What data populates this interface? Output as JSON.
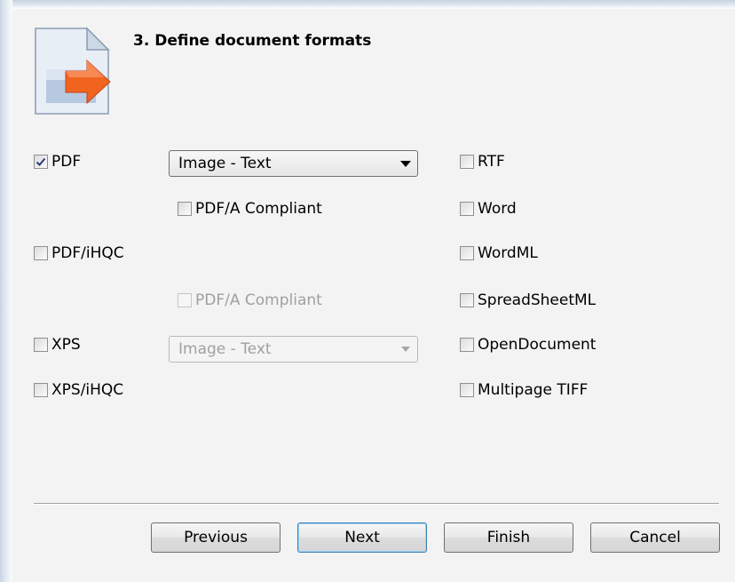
{
  "wizard": {
    "step_title": "3. Define document formats",
    "icon": "document-export-icon"
  },
  "formats": {
    "pdf": {
      "label": "PDF",
      "checked": true
    },
    "pdf_mode": {
      "selected": "Image - Text",
      "enabled": true
    },
    "pdf_a": {
      "label": "PDF/A Compliant",
      "checked": false,
      "enabled": true
    },
    "pdf_ihqc": {
      "label": "PDF/iHQC",
      "checked": false
    },
    "pdf_ihqc_a": {
      "label": "PDF/A Compliant",
      "checked": false,
      "enabled": false
    },
    "xps": {
      "label": "XPS",
      "checked": false
    },
    "xps_mode": {
      "selected": "Image - Text",
      "enabled": false
    },
    "xps_ihqc": {
      "label": "XPS/iHQC",
      "checked": false
    },
    "rtf": {
      "label": "RTF",
      "checked": false
    },
    "word": {
      "label": "Word",
      "checked": false
    },
    "wordml": {
      "label": "WordML",
      "checked": false
    },
    "spreadsheetml": {
      "label": "SpreadSheetML",
      "checked": false
    },
    "opendocument": {
      "label": "OpenDocument",
      "checked": false
    },
    "multipage_tiff": {
      "label": "Multipage TIFF",
      "checked": false
    }
  },
  "buttons": {
    "previous": "Previous",
    "next": "Next",
    "finish": "Finish",
    "cancel": "Cancel"
  },
  "colors": {
    "dialog_bg": "#f3f3f3",
    "icon_arrow": "#f0641e",
    "default_button_border": "#3c7fb1"
  }
}
